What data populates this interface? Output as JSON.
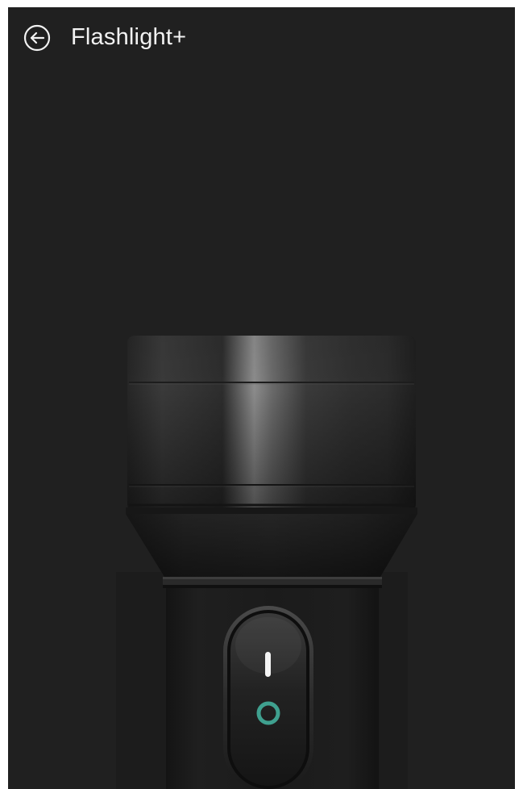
{
  "app_bar": {
    "title": "Flashlight+",
    "back_icon": "arrow-left-circle-icon"
  },
  "switch": {
    "on_icon": "power-on-bar-icon",
    "off_icon": "power-off-ring-icon",
    "state": "off",
    "accent": "#3fa08f"
  },
  "colors": {
    "background": "#202020",
    "title": "#f2f2f2"
  }
}
